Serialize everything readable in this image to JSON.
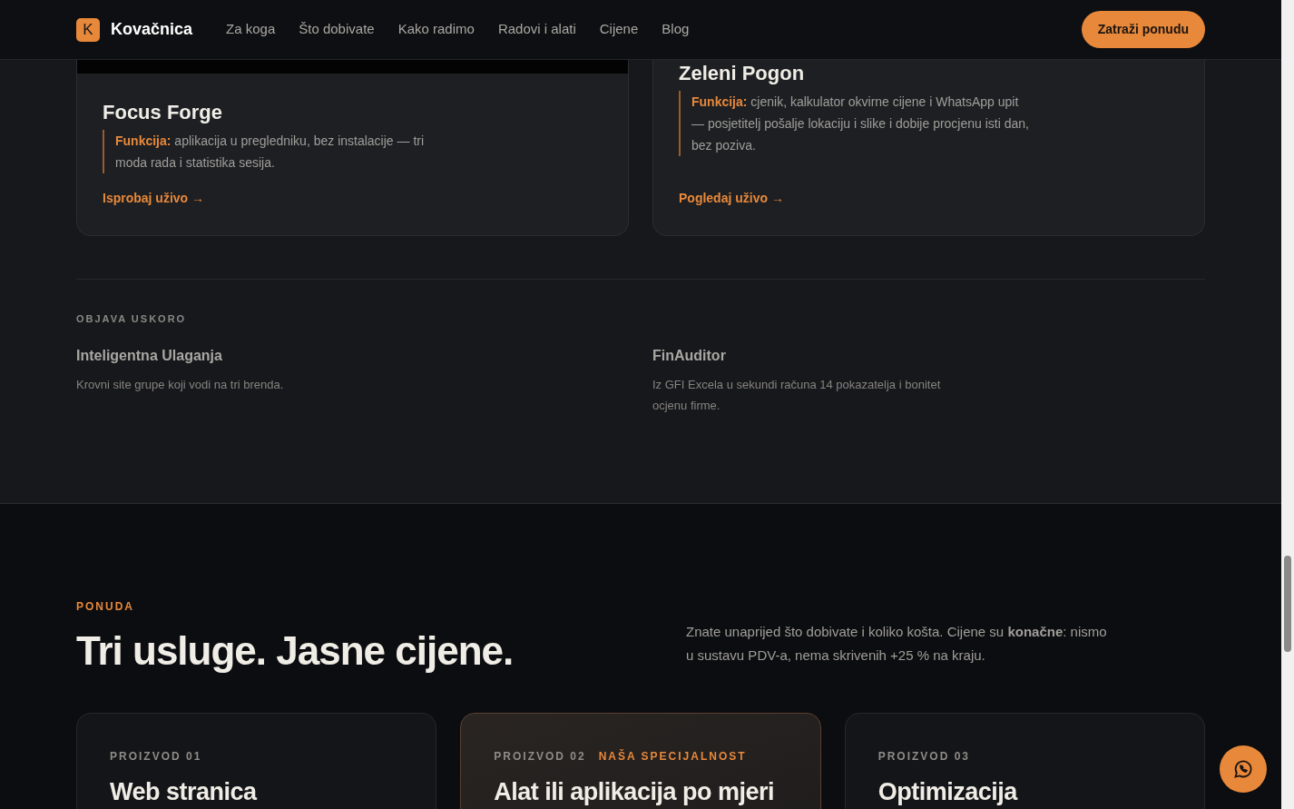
{
  "header": {
    "logo_letter": "K",
    "brand": "Kovačnica",
    "nav": [
      {
        "label": "Za koga"
      },
      {
        "label": "Što dobivate"
      },
      {
        "label": "Kako radimo"
      },
      {
        "label": "Radovi i alati"
      },
      {
        "label": "Cijene"
      },
      {
        "label": "Blog"
      }
    ],
    "cta": "Zatraži ponudu"
  },
  "projects": [
    {
      "has_image": true,
      "title": "Focus Forge",
      "function_label": "Funkcija:",
      "function_text": "aplikacija u pregledniku, bez instalacije — tri moda rada i statistika sesija.",
      "link": "Isprobaj uživo →"
    },
    {
      "has_image": false,
      "title": "Zeleni Pogon",
      "function_label": "Funkcija:",
      "function_text": "cjenik, kalkulator okvirne cijene i WhatsApp upit — posjetitelj pošalje lokaciju i slike i dobije procjenu isti dan, bez poziva.",
      "link": "Pogledaj uživo →"
    }
  ],
  "coming_soon": {
    "label": "OBJAVA USKORO",
    "items": [
      {
        "title": "Inteligentna Ulaganja",
        "text": "Krovni site grupe koji vodi na tri brenda."
      },
      {
        "title": "FinAuditor",
        "text": "Iz GFI Excela u sekundi računa 14 pokazatelja i bonitet ocjenu firme."
      }
    ]
  },
  "offer": {
    "eyebrow": "PONUDA",
    "heading": "Tri usluge. Jasne cijene.",
    "intro": "Znate unaprijed što dobivate i koliko košta. Cijene su **konačne**: nismo u sustavu PDV-a, nema skrivenih +25 % na kraju.",
    "products": [
      {
        "number": "PROIZVOD 01",
        "title": "Web stranica",
        "featured": false
      },
      {
        "number": "PROIZVOD 02",
        "badge": "NAŠA SPECIJALNOST",
        "title": "Alat ili aplikacija po mjeri",
        "featured": true
      },
      {
        "number": "PROIZVOD 03",
        "title": "Optimizacija",
        "featured": false
      }
    ]
  }
}
